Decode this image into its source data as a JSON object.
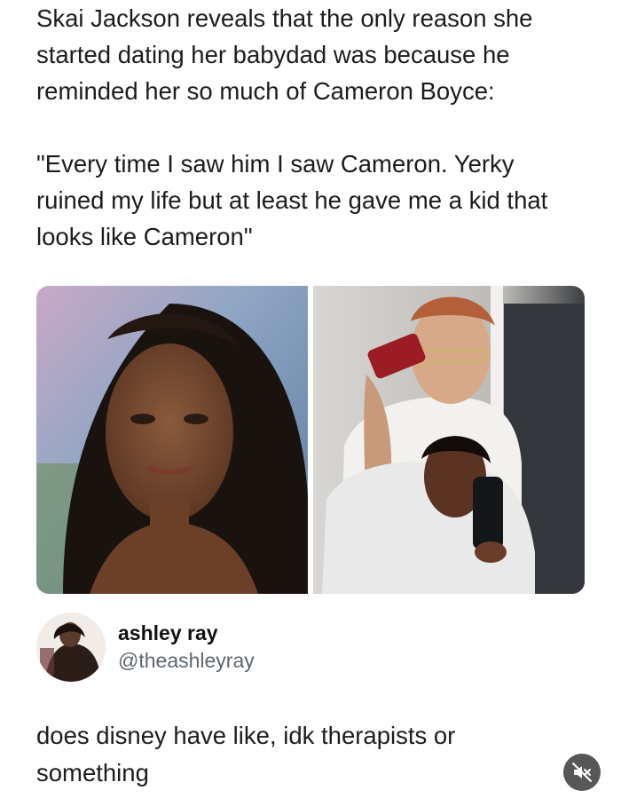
{
  "post": {
    "paragraphs": [
      "Skai Jackson reveals that the only reason she started dating her babydad was because he reminded her so much of Cameron Boyce:",
      "\"Every time I saw him I saw Cameron. Yerky ruined my life but at least he gave me a kid that looks like Cameron\""
    ],
    "images": [
      {
        "name": "portrait-photo"
      },
      {
        "name": "mirror-selfie-photo"
      }
    ]
  },
  "reply": {
    "author_name": "ashley ray",
    "author_handle": "@theashleyray",
    "text": "does disney have like, idk therapists or something"
  },
  "controls": {
    "mute_icon": "speaker-muted-icon"
  },
  "colors": {
    "text": "#1c1c1c",
    "handle": "#5c6670",
    "mute_bg": "#3a3a3a"
  }
}
